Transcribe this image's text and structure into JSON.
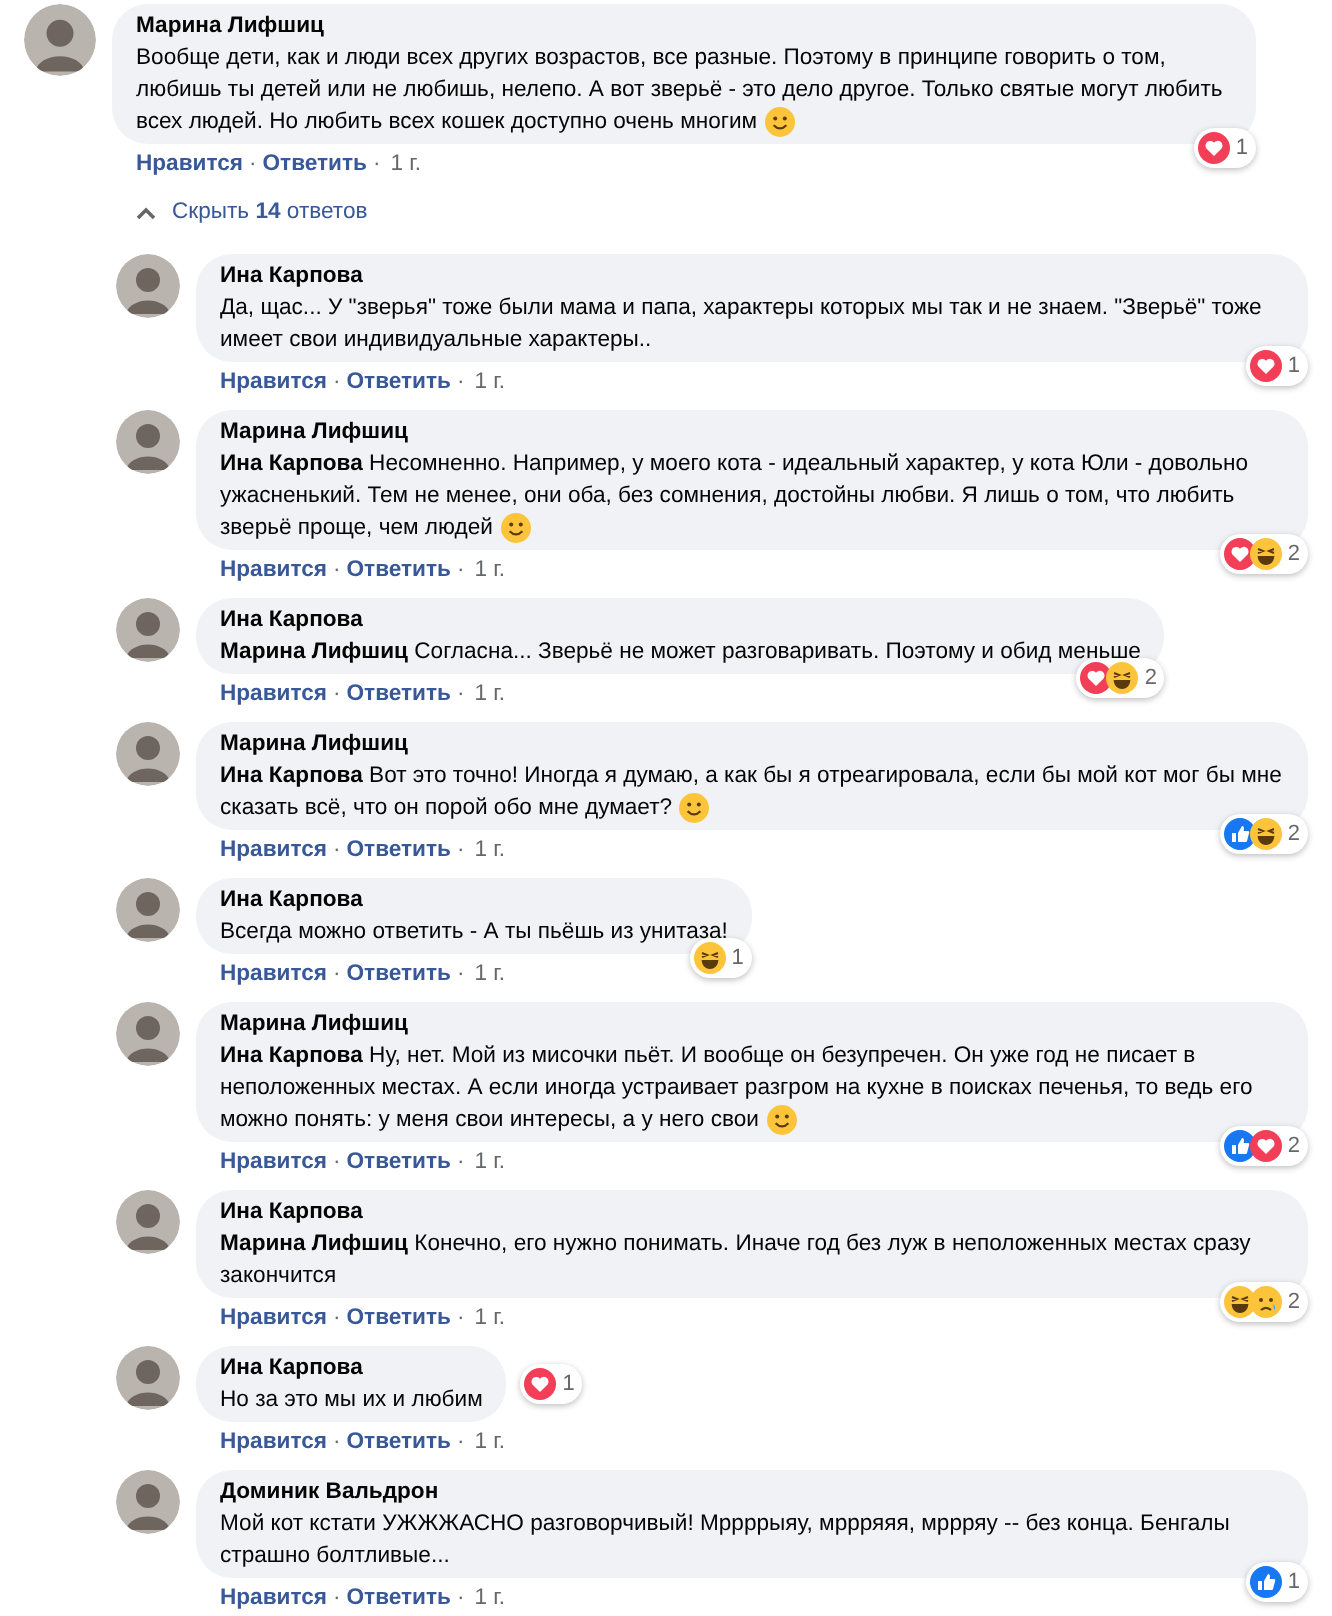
{
  "comment": {
    "author": "Марина Лифшиц",
    "text": "Вообще дети, как и люди всех других возрастов, все разные. Поэтому в принципе говорить о том, любишь ты детей или не любишь, нелепо. А вот зверьё - это дело другое. Только святые могут любить всех людей. Но любить всех кошек доступно очень многим",
    "smiley": true,
    "reactions": [
      {
        "kind": "love"
      }
    ],
    "reaction_count": "1",
    "badge_beside": false,
    "actions": [
      {
        "kind": "link",
        "text": "Нравится"
      },
      {
        "kind": "dot",
        "text": "·"
      },
      {
        "kind": "link",
        "text": "Ответить"
      },
      {
        "kind": "dot",
        "text": "·"
      },
      {
        "kind": "time",
        "text": "1 г."
      }
    ]
  },
  "hide_replies": {
    "text": "Скрыть **14** ответов"
  },
  "replies": [
    {
      "author": "Ина Карпова",
      "text": "Да, щас... У \"зверья\" тоже были мама и папа, характеры которых мы так и не знаем. \"Зверьё\" тоже имеет свои индивидуальные характеры..",
      "smiley": false,
      "reactions": [
        {
          "kind": "love"
        }
      ],
      "reaction_count": "1",
      "badge_beside": false,
      "actions": [
        {
          "kind": "link",
          "text": "Нравится"
        },
        {
          "kind": "dot",
          "text": "·"
        },
        {
          "kind": "link",
          "text": "Ответить"
        },
        {
          "kind": "dot",
          "text": "·"
        },
        {
          "kind": "time",
          "text": "1 г."
        }
      ]
    },
    {
      "author": "Марина Лифшиц",
      "text": "**Ина Карпова** Несомненно. Например, у моего кота - идеальный характер, у кота Юли - довольно ужасненький. Тем не менее, они оба, без сомнения, достойны любви. Я лишь о том, что любить зверьё проще, чем людей",
      "smiley": true,
      "reactions": [
        {
          "kind": "love"
        },
        {
          "kind": "haha"
        }
      ],
      "reaction_count": "2",
      "badge_beside": false,
      "actions": [
        {
          "kind": "link",
          "text": "Нравится"
        },
        {
          "kind": "dot",
          "text": "·"
        },
        {
          "kind": "link",
          "text": "Ответить"
        },
        {
          "kind": "dot",
          "text": "·"
        },
        {
          "kind": "time",
          "text": "1 г."
        }
      ]
    },
    {
      "author": "Ина Карпова",
      "text": "**Марина Лифшиц** Согласна... Зверьё не может разговаривать. Поэтому и обид меньше",
      "smiley": false,
      "reactions": [
        {
          "kind": "love"
        },
        {
          "kind": "haha"
        }
      ],
      "reaction_count": "2",
      "badge_beside": false,
      "actions": [
        {
          "kind": "link",
          "text": "Нравится"
        },
        {
          "kind": "dot",
          "text": "·"
        },
        {
          "kind": "link",
          "text": "Ответить"
        },
        {
          "kind": "dot",
          "text": "·"
        },
        {
          "kind": "time",
          "text": "1 г."
        }
      ]
    },
    {
      "author": "Марина Лифшиц",
      "text": "**Ина Карпова** Вот это точно! Иногда я думаю, а как бы я отреагировала, если бы мой кот мог бы мне сказать всё, что он порой обо мне думает?",
      "smiley": true,
      "reactions": [
        {
          "kind": "like"
        },
        {
          "kind": "haha"
        }
      ],
      "reaction_count": "2",
      "badge_beside": false,
      "actions": [
        {
          "kind": "link",
          "text": "Нравится"
        },
        {
          "kind": "dot",
          "text": "·"
        },
        {
          "kind": "link",
          "text": "Ответить"
        },
        {
          "kind": "dot",
          "text": "·"
        },
        {
          "kind": "time",
          "text": "1 г."
        }
      ]
    },
    {
      "author": "Ина Карпова",
      "text": "Всегда можно ответить - А ты пьёшь из унитаза!",
      "smiley": false,
      "reactions": [
        {
          "kind": "haha"
        }
      ],
      "reaction_count": "1",
      "badge_beside": false,
      "actions": [
        {
          "kind": "link",
          "text": "Нравится"
        },
        {
          "kind": "dot",
          "text": "·"
        },
        {
          "kind": "link",
          "text": "Ответить"
        },
        {
          "kind": "dot",
          "text": "·"
        },
        {
          "kind": "time",
          "text": "1 г."
        }
      ]
    },
    {
      "author": "Марина Лифшиц",
      "text": "**Ина Карпова** Ну, нет. Мой из мисочки пьёт. И вообще он безупречен. Он уже год не писает в неположенных местах. А если иногда устраивает разгром на кухне в поисках печенья, то ведь его можно понять: у меня свои интересы, а у него свои",
      "smiley": true,
      "reactions": [
        {
          "kind": "like"
        },
        {
          "kind": "love"
        }
      ],
      "reaction_count": "2",
      "badge_beside": false,
      "actions": [
        {
          "kind": "link",
          "text": "Нравится"
        },
        {
          "kind": "dot",
          "text": "·"
        },
        {
          "kind": "link",
          "text": "Ответить"
        },
        {
          "kind": "dot",
          "text": "·"
        },
        {
          "kind": "time",
          "text": "1 г."
        }
      ]
    },
    {
      "author": "Ина Карпова",
      "text": "**Марина Лифшиц** Конечно, его нужно понимать. Иначе год без луж в неположенных местах сразу закончится",
      "smiley": false,
      "reactions": [
        {
          "kind": "haha"
        },
        {
          "kind": "sad"
        }
      ],
      "reaction_count": "2",
      "badge_beside": false,
      "actions": [
        {
          "kind": "link",
          "text": "Нравится"
        },
        {
          "kind": "dot",
          "text": "·"
        },
        {
          "kind": "link",
          "text": "Ответить"
        },
        {
          "kind": "dot",
          "text": "·"
        },
        {
          "kind": "time",
          "text": "1 г."
        }
      ]
    },
    {
      "author": "Ина Карпова",
      "text": "Но за это мы их и любим",
      "smiley": false,
      "reactions": [
        {
          "kind": "love"
        }
      ],
      "reaction_count": "1",
      "badge_beside": true,
      "actions": [
        {
          "kind": "link",
          "text": "Нравится"
        },
        {
          "kind": "dot",
          "text": "·"
        },
        {
          "kind": "link",
          "text": "Ответить"
        },
        {
          "kind": "dot",
          "text": "·"
        },
        {
          "kind": "time",
          "text": "1 г."
        }
      ]
    },
    {
      "author": "Доминик Вальдрон",
      "text": "Мой кот кстати УЖЖЖАСНО разговорчивый! Мррррыяу, мррряяя, мррряу -- без конца. Бенгалы страшно болтливые...",
      "smiley": false,
      "reactions": [
        {
          "kind": "like"
        }
      ],
      "reaction_count": "1",
      "badge_beside": false,
      "actions": [
        {
          "kind": "link",
          "text": "Нравится"
        },
        {
          "kind": "dot",
          "text": "·"
        },
        {
          "kind": "link",
          "text": "Ответить"
        },
        {
          "kind": "dot",
          "text": "·"
        },
        {
          "kind": "time",
          "text": "1 г."
        }
      ]
    }
  ]
}
